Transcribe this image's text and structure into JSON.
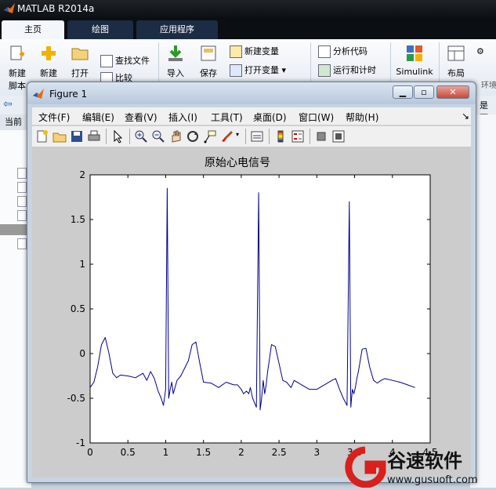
{
  "app": {
    "title": "MATLAB R2014a"
  },
  "main_tabs": [
    {
      "label": "主页"
    },
    {
      "label": "绘图"
    },
    {
      "label": "应用程序"
    }
  ],
  "ribbon": {
    "new_script": [
      "新建",
      "脚本"
    ],
    "new": "新建",
    "open": "打开",
    "find_files": "查找文件",
    "compare": "比较",
    "import": "导入",
    "save": "保存",
    "new_variable": "新建变量",
    "open_variable": "打开变量",
    "analyze_code": "分析代码",
    "run_time": "运行和计时",
    "simulink": "Simulink",
    "layout": "布局",
    "env": "环境"
  },
  "left_header": "当前",
  "right_partial": "是下",
  "figure": {
    "title": "Figure 1",
    "menu": [
      "文件(F)",
      "编辑(E)",
      "查看(V)",
      "插入(I)",
      "工具(T)",
      "桌面(D)",
      "窗口(W)",
      "帮助(H)"
    ],
    "toolbar_icons": [
      "new-figure-icon",
      "open-file-icon",
      "save-icon",
      "print-icon",
      "pointer-icon",
      "zoom-in-icon",
      "zoom-out-icon",
      "pan-hand-icon",
      "rotate-3d-icon",
      "data-cursor-icon",
      "brush-icon",
      "link-plot-icon",
      "colorbar-icon",
      "legend-icon",
      "hide-plot-tools-icon",
      "show-plot-tools-icon"
    ]
  },
  "chart_data": {
    "type": "line",
    "title": "原始心电信号",
    "xlabel": "",
    "ylabel": "",
    "xlim": [
      0,
      4.5
    ],
    "ylim": [
      -1,
      2
    ],
    "xticks": [
      "0",
      "0.5",
      "1",
      "1.5",
      "2",
      "2.5",
      "3",
      "3.5",
      "4",
      "4.5"
    ],
    "yticks": [
      "-1",
      "-0.5",
      "0",
      "0.5",
      "1",
      "1.5",
      "2"
    ],
    "grid": false,
    "color": "#00008b",
    "series": [
      {
        "x": [
          0,
          0.05,
          0.1,
          0.15,
          0.2,
          0.25,
          0.3,
          0.35,
          0.4,
          0.5,
          0.6,
          0.7,
          0.75,
          0.8,
          0.85,
          0.9,
          0.94,
          0.97,
          1.0,
          1.02,
          1.04,
          1.06,
          1.08,
          1.1,
          1.15,
          1.2,
          1.3,
          1.35,
          1.4,
          1.45,
          1.5,
          1.6,
          1.7,
          1.8,
          1.9,
          1.95,
          2.0,
          2.03,
          2.07,
          2.1,
          2.12,
          2.15,
          2.2,
          2.23,
          2.25,
          2.27,
          2.29,
          2.31,
          2.33,
          2.35,
          2.4,
          2.45,
          2.55,
          2.6,
          2.63,
          2.66,
          2.7,
          2.8,
          2.9,
          3.0,
          3.1,
          3.2,
          3.25,
          3.3,
          3.35,
          3.4,
          3.43,
          3.45,
          3.47,
          3.49,
          3.51,
          3.53,
          3.55,
          3.6,
          3.65,
          3.7,
          3.75,
          3.8,
          3.85,
          3.9,
          4.0,
          4.1,
          4.2,
          4.3
        ],
        "y": [
          -0.38,
          -0.32,
          -0.15,
          0.1,
          0.18,
          0.0,
          -0.22,
          -0.27,
          -0.24,
          -0.25,
          -0.27,
          -0.22,
          -0.3,
          -0.2,
          -0.28,
          -0.42,
          -0.5,
          -0.58,
          -0.4,
          1.85,
          -0.5,
          -0.4,
          -0.32,
          -0.45,
          -0.3,
          -0.25,
          -0.08,
          0.1,
          0.13,
          -0.1,
          -0.32,
          -0.33,
          -0.38,
          -0.32,
          -0.35,
          -0.35,
          -0.4,
          -0.45,
          -0.42,
          -0.45,
          -0.38,
          -0.5,
          -0.6,
          1.8,
          -0.63,
          -0.5,
          -0.3,
          -0.45,
          -0.35,
          -0.2,
          0.1,
          0.08,
          -0.3,
          -0.32,
          -0.35,
          -0.38,
          -0.3,
          -0.35,
          -0.4,
          -0.4,
          -0.35,
          -0.3,
          -0.28,
          -0.4,
          -0.5,
          -0.58,
          1.7,
          -0.6,
          -0.4,
          -0.45,
          -0.38,
          -0.28,
          -0.2,
          0.05,
          0.06,
          -0.15,
          -0.3,
          -0.33,
          -0.3,
          -0.28,
          -0.3,
          -0.32,
          -0.35,
          -0.38
        ]
      }
    ]
  },
  "watermark": {
    "brand": "谷速软件",
    "url": "www.gusuoft.com"
  }
}
